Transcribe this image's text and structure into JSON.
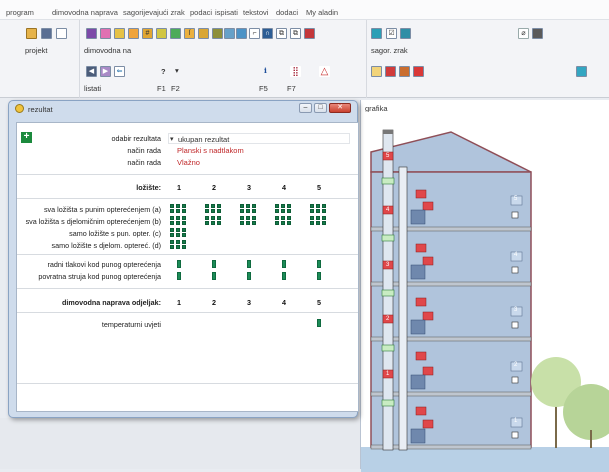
{
  "menu": [
    "program",
    "dimovodna naprava",
    "sagorijevajući zrak",
    "podaci",
    "ispisati",
    "tekstovi",
    "dodaci",
    "My aladin"
  ],
  "toolbar": {
    "label_projekt": "projekt",
    "label_dimovodna": "dimovodna na",
    "label_sagor": "sagor. zrak",
    "label_listati": "listati",
    "keys": [
      "F1",
      "F2",
      "F5",
      "F7"
    ],
    "question": "?",
    "down": "▾"
  },
  "rezultat": {
    "title": "rezultat",
    "odabir_label": "odabir rezultata",
    "odabir_value": "ukupan rezultat",
    "nacin_label": "način rada",
    "nacin_value_1": "Planski s nadtlakom",
    "nacin_value_2": "Vlažno",
    "lozista_label": "ložište:",
    "cols": [
      "1",
      "2",
      "3",
      "4",
      "5"
    ],
    "rows": [
      "sva ložišta s punim opterećenjem (a)",
      "sva ložišta s djelomičnim opterećenjem (b)",
      "samo ložište s pun. opter. (c)",
      "samo ložište s djelom. optereć. (d)"
    ],
    "rows2": [
      "radni tlakovi kod punog opterećenja",
      "povratna struja kod punog opterećenja"
    ],
    "odjeljak_label": "dimovodna naprava odjeljak:",
    "temp_label": "temperaturni uvjeti",
    "add": "+"
  },
  "grafika": {
    "title": "grafika",
    "floors": [
      "5",
      "4",
      "3",
      "2",
      "1"
    ],
    "pipe_floor_labels": [
      "5",
      "4",
      "3",
      "2",
      "1"
    ]
  },
  "colors": {
    "accent_green": "#167a4a",
    "accent_red": "#c0282a",
    "building_wall": "#b0c4dc",
    "building_outline": "#8f4f58"
  }
}
